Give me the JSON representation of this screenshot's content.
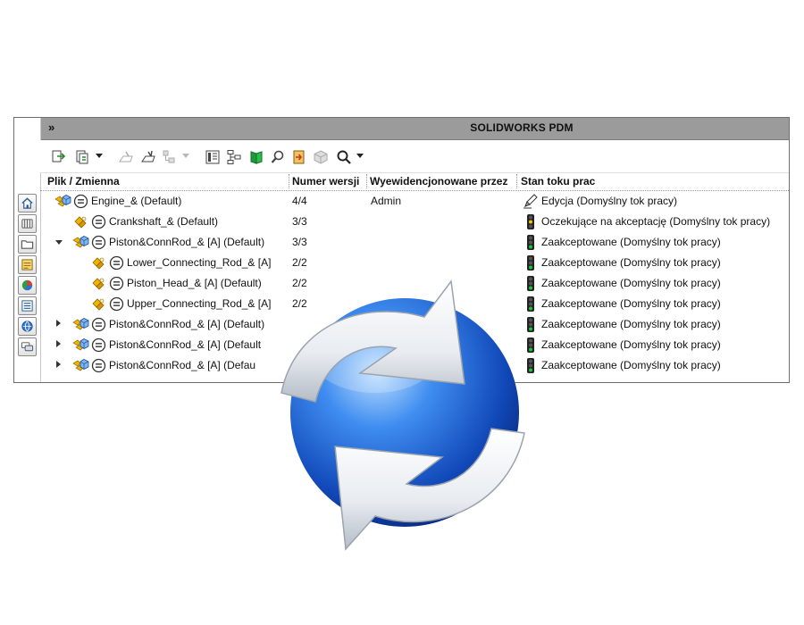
{
  "window": {
    "title": "SOLIDWORKS PDM",
    "expand_label": "»"
  },
  "columns": [
    {
      "label": "Plik / Zmienna"
    },
    {
      "label": "Numer wersji"
    },
    {
      "label": "Wyewidencjonowane przez"
    },
    {
      "label": "Stan toku prac"
    }
  ],
  "rows": [
    {
      "name": "Engine_&  (Default)",
      "version": "4/4",
      "checked_out_by": "Admin",
      "state": "Edycja (Domyślny tok pracy)",
      "state_icon": "pencil-icon",
      "level": 0,
      "tree": "none"
    },
    {
      "name": "Crankshaft_&  (Default)",
      "version": "3/3",
      "checked_out_by": "",
      "state": "Oczekujące na akceptację (Domyślny tok pracy)",
      "state_icon": "traffic-light-yellow-icon",
      "level": 1,
      "tree": "none"
    },
    {
      "name": "Piston&ConnRod_&  [A]  (Default)",
      "version": "3/3",
      "checked_out_by": "",
      "state": "Zaakceptowane (Domyślny tok pracy)",
      "state_icon": "traffic-light-green-icon",
      "level": 1,
      "tree": "expanded"
    },
    {
      "name": "Lower_Connecting_Rod_&  [A]",
      "version": "2/2",
      "checked_out_by": "",
      "state": "Zaakceptowane (Domyślny tok pracy)",
      "state_icon": "traffic-light-green-icon",
      "level": 2,
      "tree": "none"
    },
    {
      "name": "Piston_Head_&  [A]  (Default)",
      "version": "2/2",
      "checked_out_by": "",
      "state": "Zaakceptowane (Domyślny tok pracy)",
      "state_icon": "traffic-light-green-icon",
      "level": 2,
      "tree": "none"
    },
    {
      "name": "Upper_Connecting_Rod_&  [A]",
      "version": "2/2",
      "checked_out_by": "",
      "state": "Zaakceptowane (Domyślny tok pracy)",
      "state_icon": "traffic-light-green-icon",
      "level": 2,
      "tree": "none"
    },
    {
      "name": "Piston&ConnRod_&  [A]  (Default)",
      "version": "",
      "checked_out_by": "",
      "state": "Zaakceptowane (Domyślny tok pracy)",
      "state_icon": "traffic-light-green-icon",
      "level": 1,
      "tree": "collapsed"
    },
    {
      "name": "Piston&ConnRod_&  [A]  (Default",
      "version": "",
      "checked_out_by": "",
      "state": "Zaakceptowane (Domyślny tok pracy)",
      "state_icon": "traffic-light-green-icon",
      "level": 1,
      "tree": "collapsed"
    },
    {
      "name": "Piston&ConnRod_&  [A]  (Defau",
      "version": "",
      "checked_out_by": "",
      "state": "Zaakceptowane (Domyślny tok pracy)",
      "state_icon": "traffic-light-green-icon",
      "level": 1,
      "tree": "collapsed"
    }
  ],
  "icons": {
    "sidebar": [
      "home-icon",
      "vault-icon",
      "folder-icon",
      "properties-icon",
      "pie-chart-icon",
      "list-view-icon",
      "globe-icon",
      "chat-icon"
    ],
    "toolbar": [
      "check-in-icon",
      "get-version-icon",
      "change-state-icon",
      "submit-icon",
      "workflow-icon",
      "data-card-icon",
      "tree-structure-icon",
      "book-icon",
      "search-file-icon",
      "import-icon",
      "package-icon",
      "search-icon"
    ],
    "overlay": "refresh-icon"
  },
  "colors": {
    "titlebar": "#9b9b9b",
    "globe": "#1f6fe0",
    "arrow": "#e9eef3"
  }
}
